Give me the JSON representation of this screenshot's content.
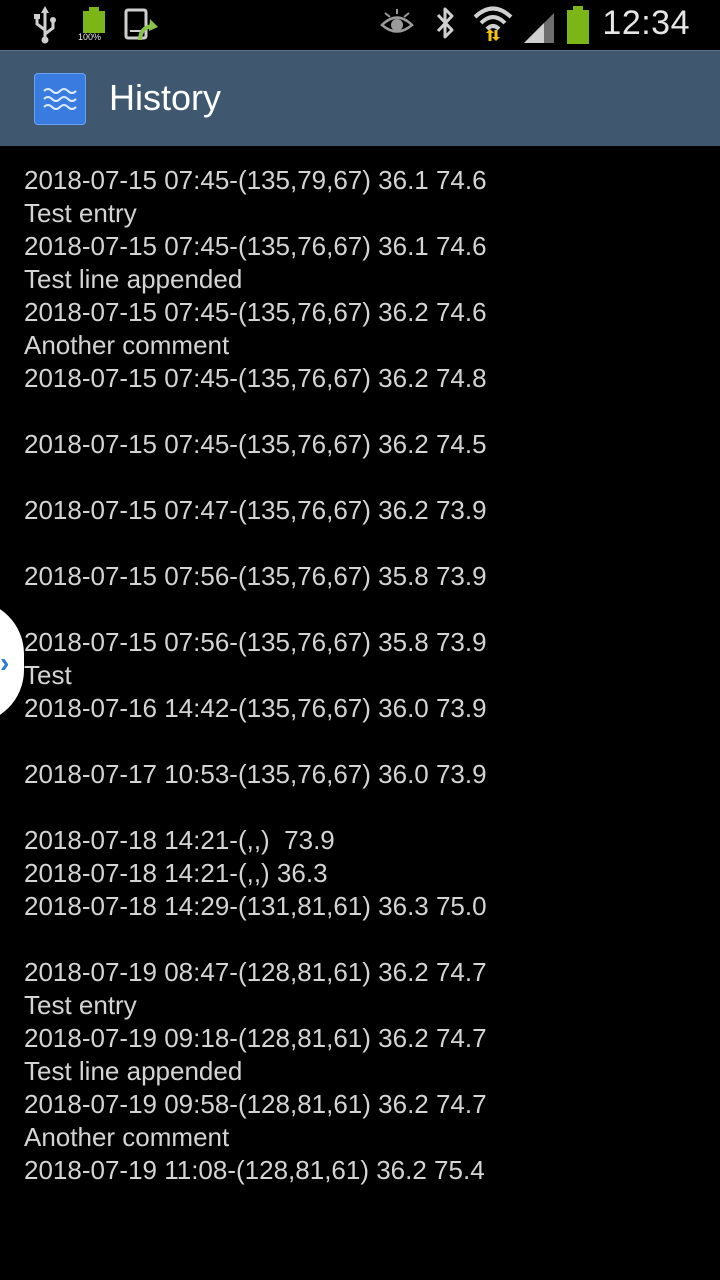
{
  "status_bar": {
    "time": "12:34",
    "battery_percent": "100%",
    "icons": [
      "usb-icon",
      "battery-full-icon",
      "sync-icon",
      "eye-icon",
      "bluetooth-icon",
      "wifi-icon",
      "signal-icon",
      "battery-icon"
    ],
    "colors": {
      "battery": "#7cb518",
      "sync_arrow": "#8bc34a",
      "wifi_arrows": "#f1c40f"
    }
  },
  "action_bar": {
    "title": "History",
    "icon": "waveform-app-icon",
    "background": "#3f5870"
  },
  "history": {
    "lines": [
      "2018-07-15 07:45-(135,79,67) 36.1 74.6",
      "Test entry",
      "2018-07-15 07:45-(135,76,67) 36.1 74.6",
      "Test line appended",
      "2018-07-15 07:45-(135,76,67) 36.2 74.6",
      "Another comment",
      "2018-07-15 07:45-(135,76,67) 36.2 74.8",
      "",
      "2018-07-15 07:45-(135,76,67) 36.2 74.5",
      "",
      "2018-07-15 07:47-(135,76,67) 36.2 73.9",
      "",
      "2018-07-15 07:56-(135,76,67) 35.8 73.9",
      "",
      "2018-07-15 07:56-(135,76,67) 35.8 73.9",
      "Test",
      "2018-07-16 14:42-(135,76,67) 36.0 73.9",
      "",
      "2018-07-17 10:53-(135,76,67) 36.0 73.9",
      "",
      "2018-07-18 14:21-(,,)  73.9",
      "2018-07-18 14:21-(,,) 36.3",
      "2018-07-18 14:29-(131,81,61) 36.3 75.0",
      "",
      "2018-07-19 08:47-(128,81,61) 36.2 74.7",
      "Test entry",
      "2018-07-19 09:18-(128,81,61) 36.2 74.7",
      "Test line appended",
      "2018-07-19 09:58-(128,81,61) 36.2 74.7",
      "Another comment",
      "2018-07-19 11:08-(128,81,61) 36.2 75.4"
    ]
  },
  "side_handle": {
    "icon": "chevron-right-icon",
    "glyph": "›"
  }
}
